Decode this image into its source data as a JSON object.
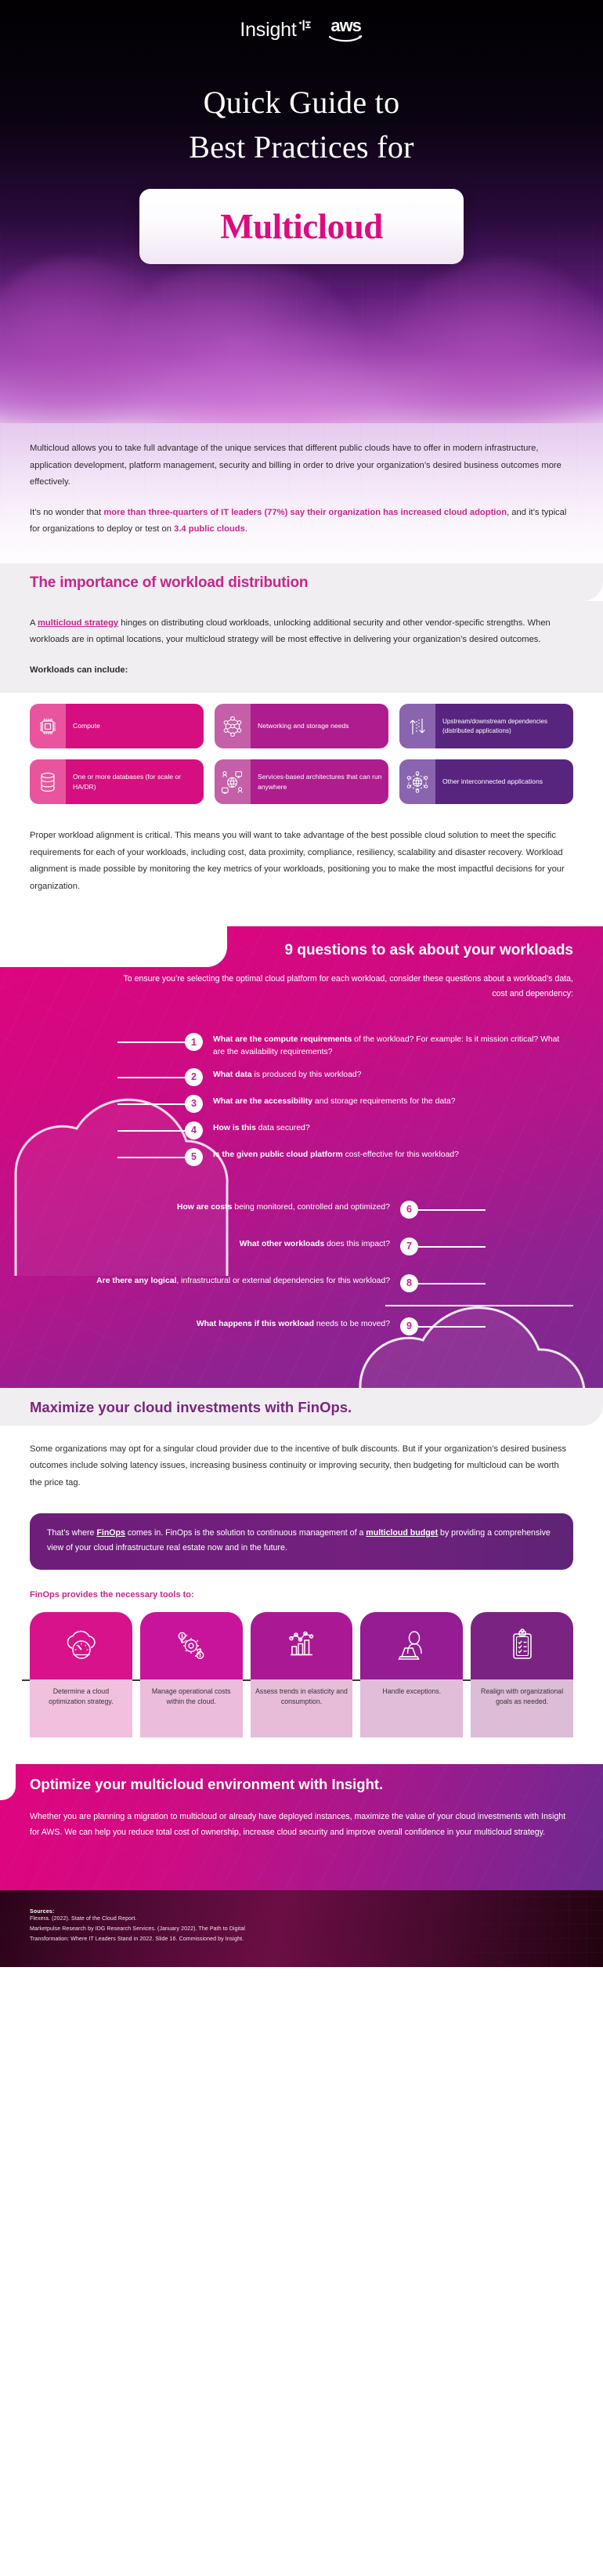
{
  "hero": {
    "logo_insight": "Insight",
    "logo_insight_icon": "insight-dot-mark-icon",
    "logo_aws": "aws",
    "logo_aws_icon": "aws-smile-icon",
    "title_line1": "Quick Guide to",
    "title_line2": "Best Practices for",
    "badge_word": "Multicloud"
  },
  "intro": {
    "p1": "Multicloud allows you to take full advantage of the unique services that different public clouds have to offer in modern infrastructure, application development, platform management, security and billing in order to drive your organization’s desired business outcomes more effectively.",
    "p2_a": "It’s no wonder that ",
    "p2_b": "more than three-quarters of IT leaders (77%) say their organization has increased cloud adoption",
    "p2_c": ", and it’s typical for organizations to deploy or test on ",
    "p2_d": "3.4 public clouds",
    "p2_e": "."
  },
  "workload": {
    "heading": "The importance of workload distribution",
    "p1_a": "A ",
    "p1_link": "multicloud strategy",
    "p1_b": " hinges on distributing cloud workloads, unlocking additional security and other vendor-specific strengths. When workloads are in optimal locations, your multicloud strategy will be most effective in delivering your organization’s desired outcomes.",
    "subhead": "Workloads can include:",
    "cards": [
      {
        "label": "Compute",
        "icon": "cpu-chip-icon",
        "tone": "pink"
      },
      {
        "label": "Networking and storage needs",
        "icon": "network-nodes-icon",
        "tone": "mag"
      },
      {
        "label": "Upstream/downstream dependencies (distributed applications)",
        "icon": "up-down-arrows-icon",
        "tone": "pur"
      },
      {
        "label": "One or more databases (for scale or HA/DR)",
        "icon": "database-stack-icon",
        "tone": "pink"
      },
      {
        "label": "Services-based architectures that can run anywhere",
        "icon": "services-globe-icon",
        "tone": "mag"
      },
      {
        "label": "Other interconnected applications",
        "icon": "interconnected-globe-icon",
        "tone": "pur"
      }
    ],
    "p2": "Proper workload alignment is critical. This means you will want to take advantage of the best possible cloud solution to meet the specific requirements for each of your workloads, including cost, data proximity, compliance, resiliency, scalability and disaster recovery. Workload alignment is made possible by monitoring the key metrics of your workloads, positioning you to make the most impactful decisions for your organization."
  },
  "questions": {
    "heading": "9 questions to ask about your workloads",
    "intro": "To ensure you’re selecting the optimal cloud platform for each workload, consider these questions about a workload’s data, cost and dependency:",
    "items": [
      {
        "n": "1",
        "side": "right",
        "bold": "What are the compute requirements",
        "rest": " of the workload? For example: Is it mission critical? What are the availability requirements?"
      },
      {
        "n": "2",
        "side": "right",
        "bold": "What data",
        "rest": " is produced by this workload?"
      },
      {
        "n": "3",
        "side": "right",
        "bold": "What are the accessibility",
        "rest": " and storage requirements for the data?"
      },
      {
        "n": "4",
        "side": "right",
        "bold": "How is this",
        "rest": " data secured?"
      },
      {
        "n": "5",
        "side": "right",
        "bold": "Is the given public cloud platform",
        "rest": " cost-effective for this workload?"
      },
      {
        "n": "6",
        "side": "left",
        "bold": "How are costs",
        "rest": " being monitored, controlled and optimized?"
      },
      {
        "n": "7",
        "side": "left",
        "bold": "What other workloads",
        "rest": " does this impact?"
      },
      {
        "n": "8",
        "side": "left",
        "bold": "Are there any logical",
        "rest": ", infrastructural or external dependencies for this workload?"
      },
      {
        "n": "9",
        "side": "left",
        "bold": "What happens if this workload",
        "rest": " needs to be moved?"
      }
    ]
  },
  "finops": {
    "heading": "Maximize your cloud investments with FinOps.",
    "p1": "Some organizations may opt for a singular cloud provider due to the incentive of bulk discounts. But if your organization’s desired business outcomes include solving latency issues, increasing business continuity or improving security, then budgeting for multicloud can be worth the price tag.",
    "callout_a": "That’s where ",
    "callout_link1": "FinOps",
    "callout_b": " comes in. FinOps is the solution to continuous management of a ",
    "callout_link2": "multicloud budget",
    "callout_c": " by providing a comprehensive view of your cloud infrastructure real estate now and in the future.",
    "subhead": "FinOps provides the necessary tools to:",
    "tools": [
      {
        "label": "Determine a cloud optimization strategy.",
        "icon": "cloud-gauge-icon",
        "top": "#D8128A",
        "bot": "#F0C0DE"
      },
      {
        "label": "Manage operational costs within the cloud.",
        "icon": "gear-dollar-cycle-icon",
        "top": "#C8149A",
        "bot": "#EBBCDC"
      },
      {
        "label": "Assess trends in elasticity and consumption.",
        "icon": "bar-chart-trend-icon",
        "top": "#AB1894",
        "bot": "#E6BCD9"
      },
      {
        "label": "Handle exceptions.",
        "icon": "person-laptop-icon",
        "top": "#951C92",
        "bot": "#E2BDD9"
      },
      {
        "label": "Realign with organizational goals as needed.",
        "icon": "clipboard-checklist-icon",
        "top": "#7B2382",
        "bot": "#DCBCD7"
      }
    ]
  },
  "optimize": {
    "heading": "Optimize your multicloud environment with Insight.",
    "body": "Whether you are planning a migration to multicloud or already have deployed instances, maximize the value of your cloud investments with Insight for AWS. We can help you reduce total cost of ownership, increase cloud security and improve overall confidence in your multicloud strategy."
  },
  "footer": {
    "sources_label": "Sources:",
    "source1": "Flexera. (2022). State of the Cloud Report.",
    "source2": "Marketpulse Research by IDG Research Services. (January 2022). The Path to Digital",
    "source3": "Transformation: Where IT Leaders Stand in 2022. Slide 16. Commissioned by Insight."
  },
  "colors": {
    "magenta": "#C6258C",
    "hot_pink": "#DE0A7F",
    "purple": "#7B2382",
    "deep_purple": "#58257E"
  }
}
